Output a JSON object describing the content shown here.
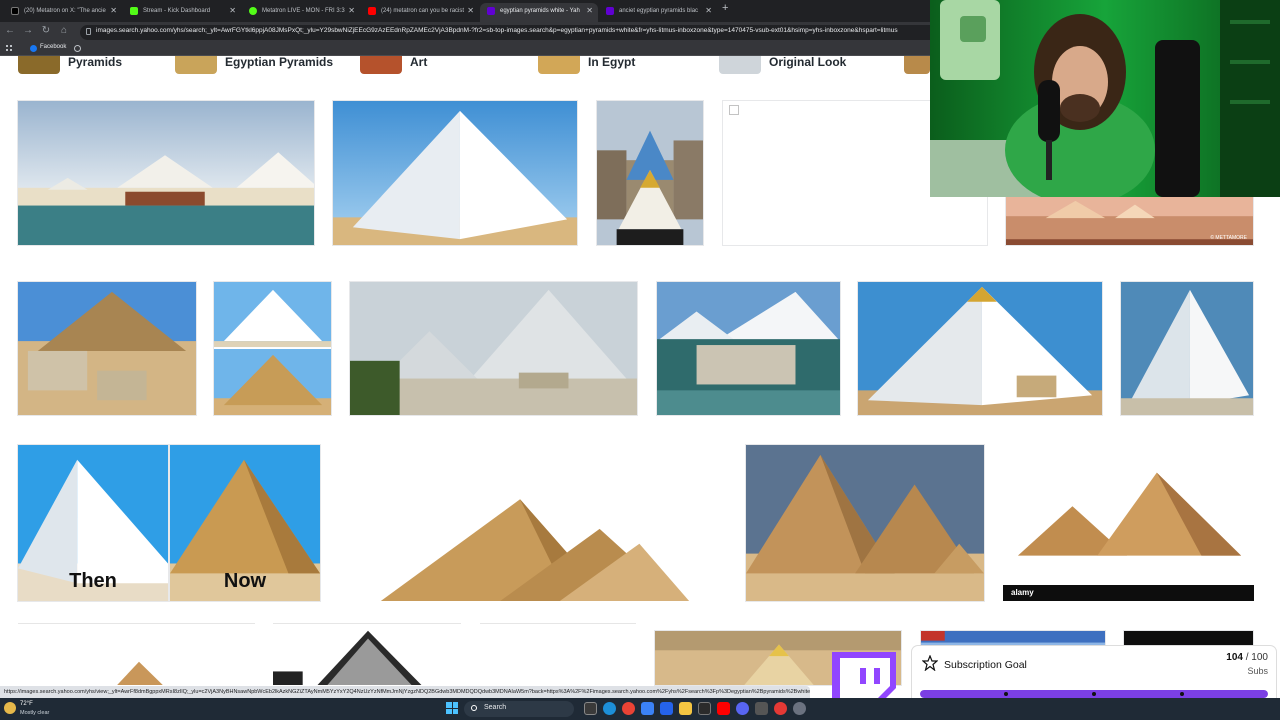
{
  "browser": {
    "tabs": [
      {
        "title": "(20) Metatron on X: \"The ancie",
        "icon": "x-icon",
        "color": "#000000",
        "active": false
      },
      {
        "title": "Stream - Kick Dashboard",
        "icon": "kick-icon",
        "color": "#53fc18",
        "active": false
      },
      {
        "title": "Metatron LIVE - MON - FRI 3:3",
        "icon": "play-icon",
        "color": "#53fc18",
        "active": false
      },
      {
        "title": "(24) metatron can you be racist",
        "icon": "youtube-icon",
        "color": "#ff0000",
        "active": false
      },
      {
        "title": "egyptian pyramids white - Yah",
        "icon": "yahoo-icon",
        "color": "#6001d2",
        "active": true
      },
      {
        "title": "anciet egyptian pyramids blac",
        "icon": "yahoo-icon",
        "color": "#6001d2",
        "active": false
      }
    ],
    "new_tab": "+",
    "tab_close": "✕",
    "back": "←",
    "forward": "→",
    "reload": "↻",
    "home": "⌂",
    "url": "images.search.yahoo.com/yhs/search;_ylt=AwrFGYtkl6ppjA08JMsPxQt;_ylu=Y29sbwNiZjEEcG9zAzEEdnRpZAMEc2VjA3BpdnM-?fr2=sb-top-images.search&p=egyptian+pyramids+white&fr=yhs-litmus-inboxzone&type=1470475-vsub-ext01&hsimp=yhs-inboxzone&hspart=litmus",
    "bookmarks": [
      {
        "label": "Facebook",
        "icon": "facebook-icon"
      }
    ],
    "status_url": "https://images.search.yahoo.com/yhs/view;_ylt=AwrFf8dmBgppxMRsI8zIlQ;_ylu=c2VjA3NyBHNsawNpbWcEb2lkAzkNGZiZTAyNmM5YzYxY2Q4NzUzYzNfMmJmNjYzgzNDQ2BGdwb3MDMDQDQdwb3MDNAIaW5m?back=https%3A%2F%2Fimages.search.yahoo.com%2Fyhs%2Fsearch%3Fp%3Degyptian%2Bpyramids%2Bwhite"
  },
  "categories": [
    {
      "label": "Pyramids",
      "color": "#8a6a2a"
    },
    {
      "label": "Egyptian Pyramids",
      "color": "#c9a45a"
    },
    {
      "label": "Art",
      "color": "#b5522c"
    },
    {
      "label": "In Egypt",
      "color": "#d2a757"
    },
    {
      "label": "Original Look",
      "color": "#cfd5da"
    }
  ],
  "overlay": {
    "then": "Then",
    "now": "Now",
    "alamy": "alamy",
    "watermark": "© METTAMORE"
  },
  "subscription_goal": {
    "title": "Subscription Goal",
    "current": "104",
    "target": "/ 100",
    "unit": "Subs",
    "progress": 1.0
  },
  "taskbar": {
    "temp": "72°F",
    "condition": "Mostly clear",
    "search": "Search"
  },
  "icons": {
    "star": "star-icon",
    "twitch": "twitch-logo-icon",
    "windows": "windows-start-icon"
  },
  "colors": {
    "browser_dark": "#202124",
    "toolbar": "#35363a",
    "twitch_purple": "#9146ff",
    "goal_fill": "#7b3fe4"
  }
}
